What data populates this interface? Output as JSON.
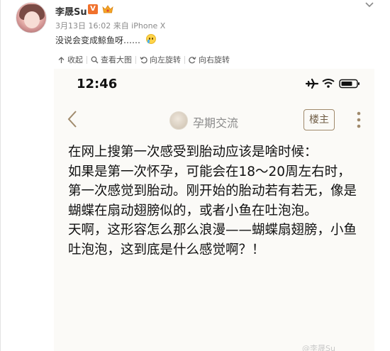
{
  "post": {
    "username": "李晟Su",
    "verified_badge": "V",
    "meta": "3月13日 16:02 来自 iPhone X",
    "text": "没说会变成鲸鱼呀……",
    "emoji": "sweat-smile-emoji"
  },
  "toolbar": {
    "items": [
      {
        "label": "收起",
        "icon": "collapse-arrow-icon"
      },
      {
        "label": "查看大图",
        "icon": "magnifier-icon"
      },
      {
        "label": "向左旋转",
        "icon": "rotate-left-icon"
      },
      {
        "label": "向右旋转",
        "icon": "rotate-right-icon"
      }
    ]
  },
  "screenshot": {
    "status_time": "12:46",
    "nav": {
      "title": "孕期交流",
      "owner_button": "楼主"
    },
    "paragraphs": [
      "在网上搜第一次感受到胎动应该是啥时候：",
      "如果是第一次怀孕，可能会在18～20周左右时，第一次感觉到胎动。刚开始的胎动若有若无，像是蝴蝶在扇动翅膀似的，或者小鱼在吐泡泡。",
      "天啊，这形容怎么那么浪漫——蝴蝶扇翅膀，小鱼吐泡泡，这到底是什么感觉啊？！"
    ]
  },
  "watermark": "@李晟Su",
  "colors": {
    "verified": "#f0712c",
    "owner_border": "#a08a6c",
    "screenshot_bg": "#fbfaf7"
  }
}
